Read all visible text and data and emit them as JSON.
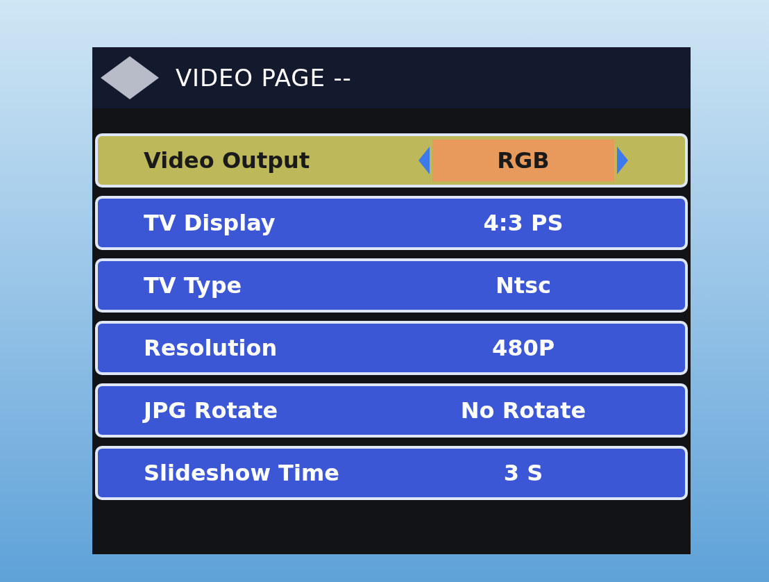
{
  "header": {
    "title": "VIDEO PAGE --"
  },
  "rows": [
    {
      "label": "Video Output",
      "value": "RGB",
      "selected": true
    },
    {
      "label": "TV Display",
      "value": "4:3 PS",
      "selected": false
    },
    {
      "label": "TV Type",
      "value": "Ntsc",
      "selected": false
    },
    {
      "label": "Resolution",
      "value": "480P",
      "selected": false
    },
    {
      "label": "JPG Rotate",
      "value": "No Rotate",
      "selected": false
    },
    {
      "label": "Slideshow Time",
      "value": "3 S",
      "selected": false
    }
  ]
}
